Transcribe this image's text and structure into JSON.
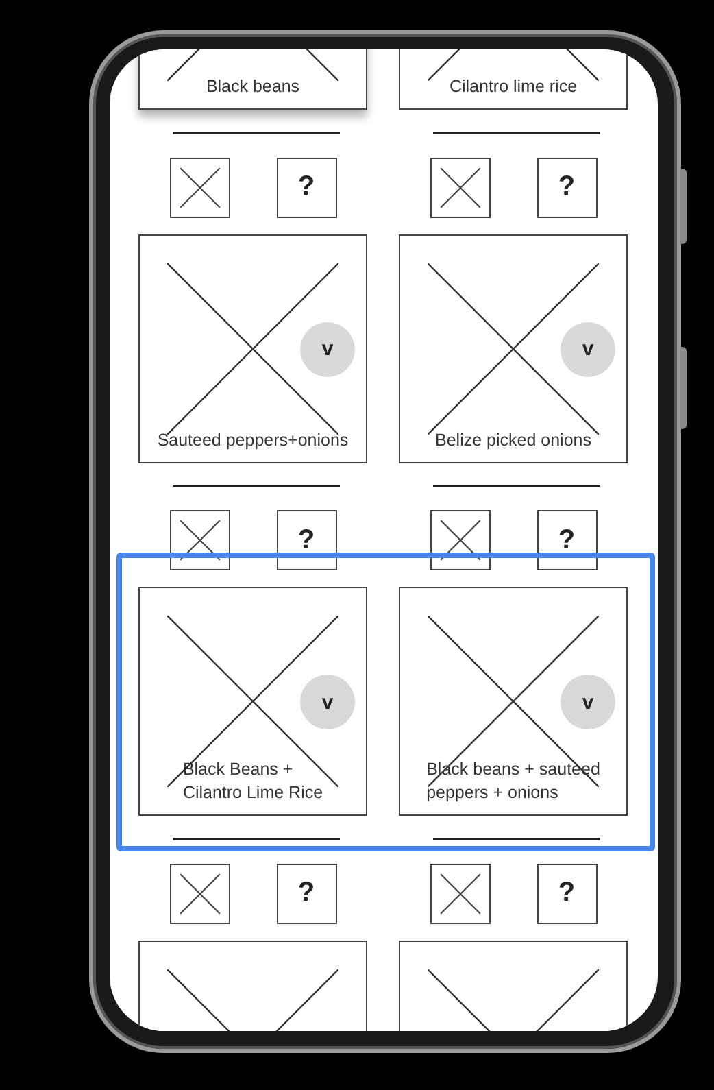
{
  "rows": [
    {
      "selected": false,
      "items": [
        {
          "kind": "card",
          "label": "Black beans",
          "help": "?",
          "shadow": true
        },
        {
          "kind": "card",
          "label": "Cilantro lime rice",
          "help": "?",
          "shadow": false
        }
      ]
    },
    {
      "selected": false,
      "items": [
        {
          "kind": "card",
          "label": "Sauteed peppers+onions",
          "badge": "v",
          "help": "?"
        },
        {
          "kind": "card",
          "label": "Belize picked onions",
          "badge": "v",
          "help": "?"
        }
      ]
    },
    {
      "selected": true,
      "items": [
        {
          "kind": "card",
          "label": "Black Beans +\nCilantro Lime Rice",
          "badge": "v",
          "help": "?"
        },
        {
          "kind": "card",
          "label": "Black beans + sauteed\npeppers + onions",
          "badge": "v",
          "help": "?"
        }
      ]
    },
    {
      "selected": false,
      "items": [
        {
          "kind": "card"
        },
        {
          "kind": "card"
        }
      ]
    }
  ]
}
